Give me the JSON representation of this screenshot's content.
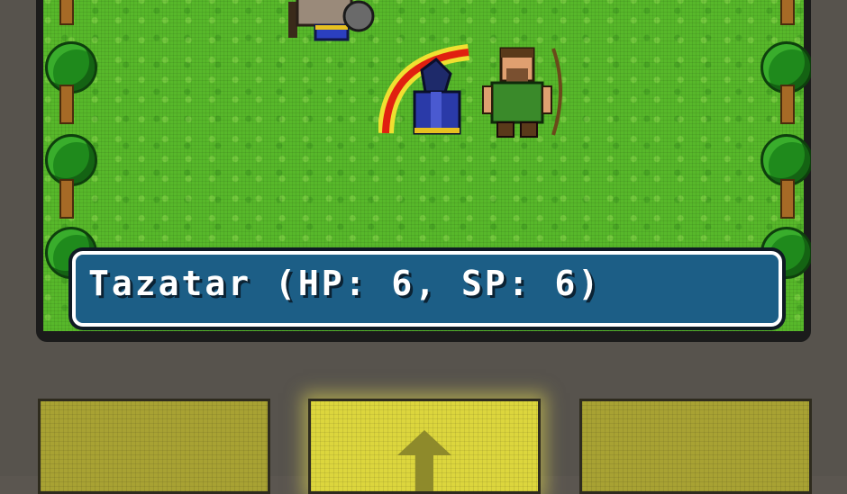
{
  "message": {
    "text": "Tazatar (HP: 6, SP: 6)"
  },
  "party": [
    {
      "role": "warrior",
      "icon": "warrior-sprite"
    },
    {
      "role": "mage",
      "icon": "mage-sprite"
    },
    {
      "role": "archer",
      "icon": "archer-sprite"
    }
  ],
  "controls": [
    {
      "name": "left-action",
      "icon": ""
    },
    {
      "name": "move-up",
      "icon": "up-arrow-icon"
    },
    {
      "name": "right-action",
      "icon": ""
    }
  ],
  "colors": {
    "grass": "#57b82a",
    "message_bg": "#1c5e86",
    "button": "#a8a233",
    "button_active": "#dcd63d"
  }
}
